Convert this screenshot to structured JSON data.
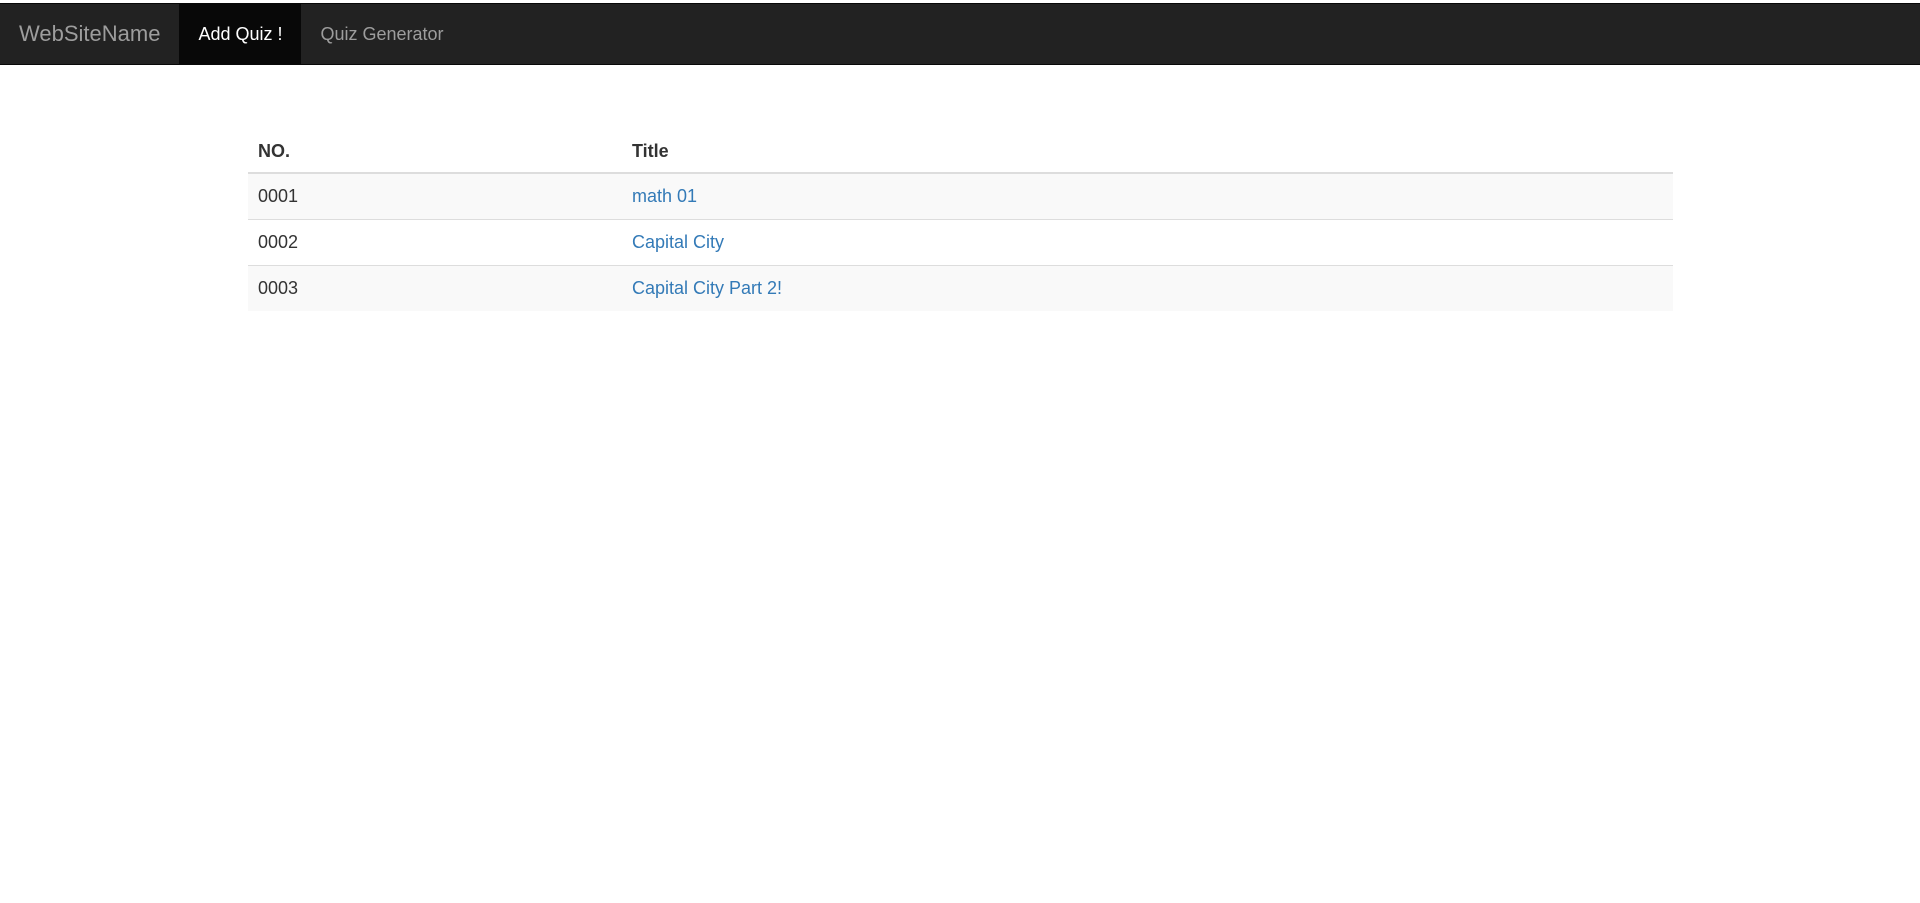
{
  "navbar": {
    "brand": "WebSiteName",
    "items": [
      {
        "label": "Add Quiz !",
        "active": true
      },
      {
        "label": "Quiz Generator",
        "active": false
      }
    ]
  },
  "table": {
    "headers": {
      "no": "NO.",
      "title": "Title"
    },
    "rows": [
      {
        "no": "0001",
        "title": "math 01"
      },
      {
        "no": "0002",
        "title": "Capital City"
      },
      {
        "no": "0003",
        "title": "Capital City Part 2!"
      }
    ]
  },
  "colors": {
    "navbar_bg": "#222222",
    "active_item_bg": "#080808",
    "link": "#337ab7",
    "stripe": "#f9f9f9"
  }
}
